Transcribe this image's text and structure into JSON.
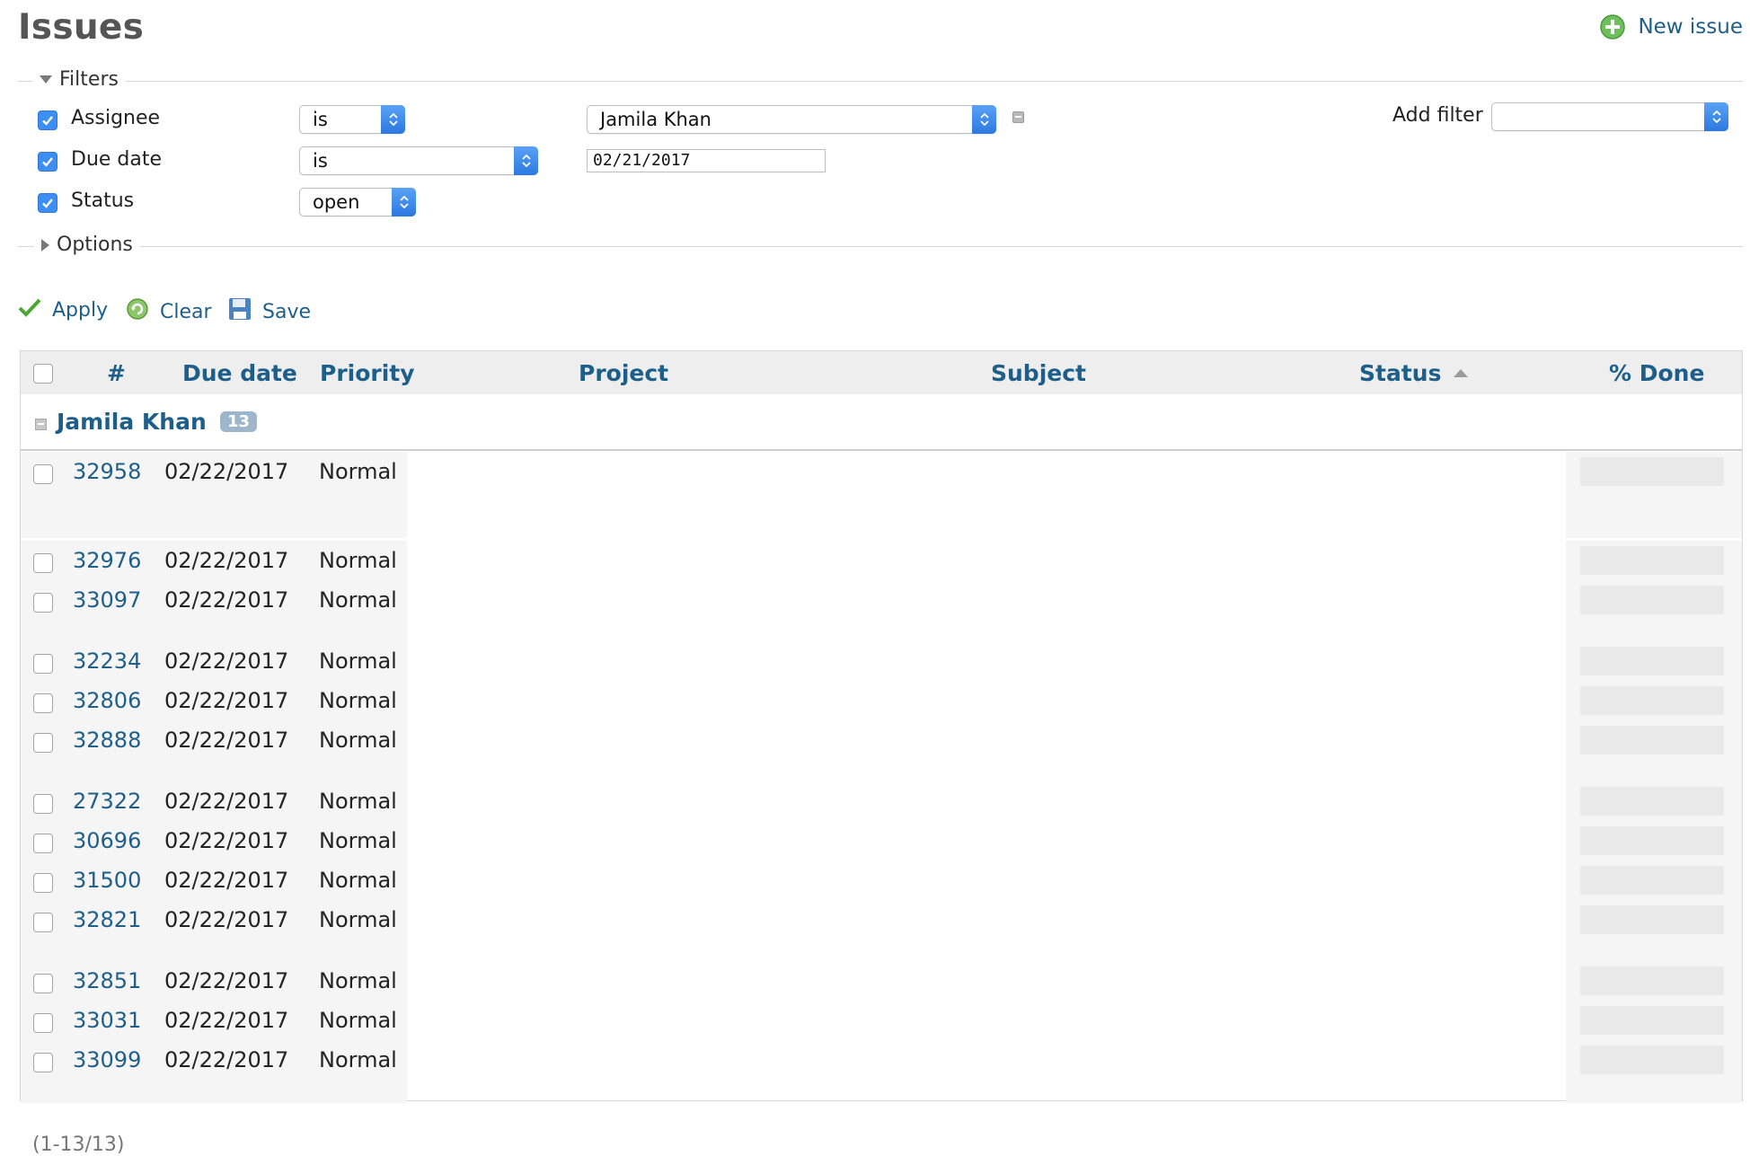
{
  "page": {
    "title": "Issues",
    "new_issue": "New issue"
  },
  "filters": {
    "legend": "Filters",
    "rows": [
      {
        "label": "Assignee",
        "operator": "is",
        "value": "Jamila Khan"
      },
      {
        "label": "Due date",
        "operator": "is",
        "value": "02/21/2017"
      },
      {
        "label": "Status",
        "operator": "open"
      }
    ],
    "add_filter_label": "Add filter",
    "add_filter_value": ""
  },
  "options": {
    "legend": "Options"
  },
  "actions": {
    "apply": "Apply",
    "clear": "Clear",
    "save": "Save"
  },
  "table": {
    "columns": [
      "#",
      "Due date",
      "Priority",
      "Project",
      "Subject",
      "Status",
      "% Done"
    ],
    "group": {
      "name": "Jamila Khan",
      "count": "13"
    },
    "rows": [
      {
        "id": "32958",
        "due": "02/22/2017",
        "priority": "Normal"
      },
      {
        "id": "32976",
        "due": "02/22/2017",
        "priority": "Normal"
      },
      {
        "id": "33097",
        "due": "02/22/2017",
        "priority": "Normal"
      },
      {
        "id": "32234",
        "due": "02/22/2017",
        "priority": "Normal"
      },
      {
        "id": "32806",
        "due": "02/22/2017",
        "priority": "Normal"
      },
      {
        "id": "32888",
        "due": "02/22/2017",
        "priority": "Normal"
      },
      {
        "id": "27322",
        "due": "02/22/2017",
        "priority": "Normal"
      },
      {
        "id": "30696",
        "due": "02/22/2017",
        "priority": "Normal"
      },
      {
        "id": "31500",
        "due": "02/22/2017",
        "priority": "Normal"
      },
      {
        "id": "32821",
        "due": "02/22/2017",
        "priority": "Normal"
      },
      {
        "id": "32851",
        "due": "02/22/2017",
        "priority": "Normal"
      },
      {
        "id": "33031",
        "due": "02/22/2017",
        "priority": "Normal"
      },
      {
        "id": "33099",
        "due": "02/22/2017",
        "priority": "Normal"
      }
    ]
  },
  "pagination": "(1-13/13)",
  "colors": {
    "link": "#1d5f8a",
    "checkbox": "#3c8ef3",
    "header_bg": "#eeeeee"
  }
}
